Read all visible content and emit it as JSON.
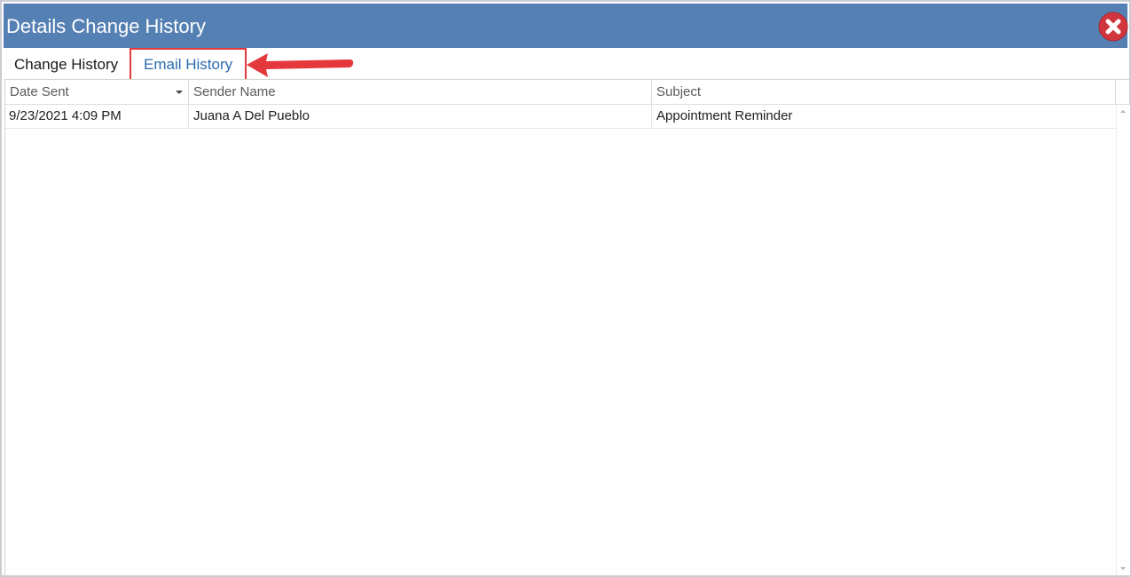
{
  "window": {
    "title": "Details Change History"
  },
  "tabs": [
    {
      "label": "Change History",
      "active": false
    },
    {
      "label": "Email History",
      "active": true
    }
  ],
  "grid": {
    "columns": [
      {
        "label": "Date Sent",
        "sort": "descending"
      },
      {
        "label": "Sender Name"
      },
      {
        "label": "Subject"
      }
    ],
    "rows": [
      {
        "date_sent": "9/23/2021 4:09 PM",
        "sender_name": "Juana A Del Pueblo",
        "subject": "Appointment Reminder"
      }
    ]
  },
  "colors": {
    "titlebar": "#5580b3",
    "active_tab_text": "#2b6cb0",
    "annotation": "#e5383c",
    "close_button": "#d0343d"
  },
  "icons": {
    "close": "close-x-icon",
    "sort": "sort-descending-icon",
    "annotation_arrow": "arrow-left-icon"
  }
}
